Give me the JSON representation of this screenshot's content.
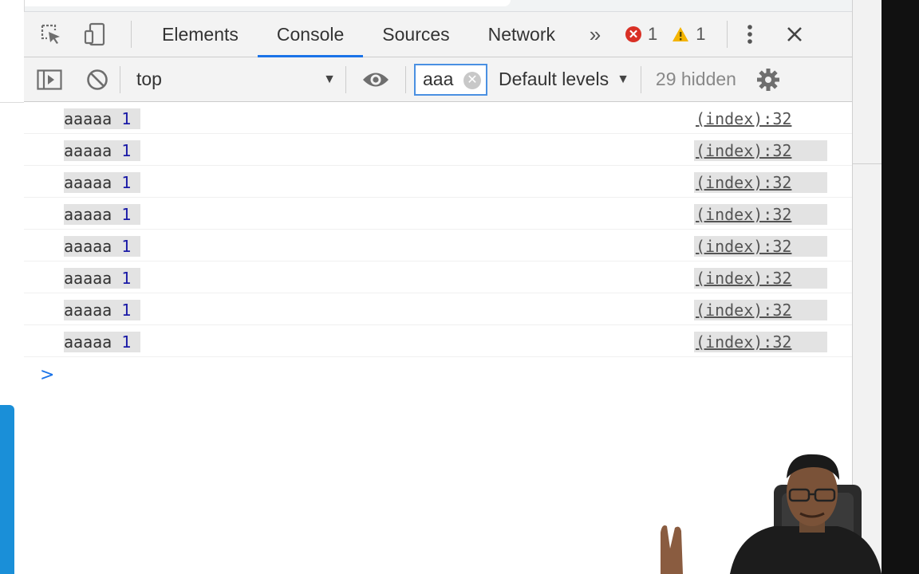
{
  "devtools": {
    "tabs": [
      {
        "label": "Elements"
      },
      {
        "label": "Console"
      },
      {
        "label": "Sources"
      },
      {
        "label": "Network"
      }
    ],
    "more_tabs_label": "»",
    "error_count": "1",
    "warning_count": "1"
  },
  "toolbar": {
    "context": "top",
    "filter_value": "aaa",
    "levels_label": "Default levels",
    "hidden_label": "29 hidden"
  },
  "messages": [
    {
      "text": "aaaaa",
      "value": "1",
      "source": "(index):32"
    },
    {
      "text": "aaaaa",
      "value": "1",
      "source": "(index):32"
    },
    {
      "text": "aaaaa",
      "value": "1",
      "source": "(index):32"
    },
    {
      "text": "aaaaa",
      "value": "1",
      "source": "(index):32"
    },
    {
      "text": "aaaaa",
      "value": "1",
      "source": "(index):32"
    },
    {
      "text": "aaaaa",
      "value": "1",
      "source": "(index):32"
    },
    {
      "text": "aaaaa",
      "value": "1",
      "source": "(index):32"
    },
    {
      "text": "aaaaa",
      "value": "1",
      "source": "(index):32"
    }
  ],
  "prompt_symbol": ">",
  "colors": {
    "accent": "#1a73e8",
    "error": "#d93025",
    "warning": "#f4b400",
    "number": "#1a1aa6",
    "panel_bg": "#f3f3f3"
  }
}
